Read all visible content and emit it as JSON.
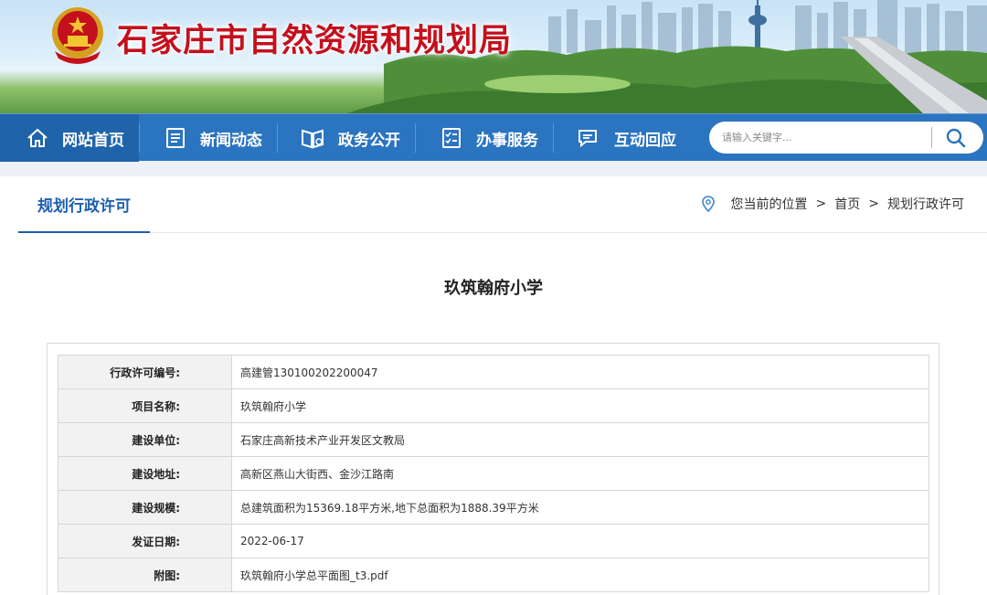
{
  "header": {
    "site_title": "石家庄市自然资源和规划局"
  },
  "nav": {
    "items": [
      {
        "label": "网站首页",
        "icon": "home-icon"
      },
      {
        "label": "新闻动态",
        "icon": "news-icon"
      },
      {
        "label": "政务公开",
        "icon": "book-icon"
      },
      {
        "label": "办事服务",
        "icon": "checklist-icon"
      },
      {
        "label": "互动回应",
        "icon": "chat-icon"
      }
    ],
    "search": {
      "placeholder": "请输入关键字...",
      "icon": "search-icon"
    }
  },
  "section": {
    "title": "规划行政许可",
    "breadcrumb": {
      "prefix": "您当前的位置",
      "items": [
        "首页",
        "规划行政许可"
      ],
      "separator": ">"
    }
  },
  "document": {
    "title": "玖筑翰府小学",
    "rows": [
      {
        "label": "行政许可编号:",
        "value": "高建管130100202200047"
      },
      {
        "label": "项目名称:",
        "value": "玖筑翰府小学"
      },
      {
        "label": "建设单位:",
        "value": "石家庄高新技术产业开发区文教局"
      },
      {
        "label": "建设地址:",
        "value": "高新区燕山大街西、金沙江路南"
      },
      {
        "label": "建设规模:",
        "value": "总建筑面积为15369.18平方米,地下总面积为1888.39平方米"
      },
      {
        "label": "发证日期:",
        "value": "2022-06-17"
      },
      {
        "label": "附图:",
        "value": "玖筑翰府小学总平面图_t3.pdf"
      }
    ]
  },
  "colors": {
    "nav_bg": "#2b74c0",
    "nav_active": "#1f63aa",
    "title_red": "#c4101d",
    "accent_blue": "#1d5fb0"
  }
}
